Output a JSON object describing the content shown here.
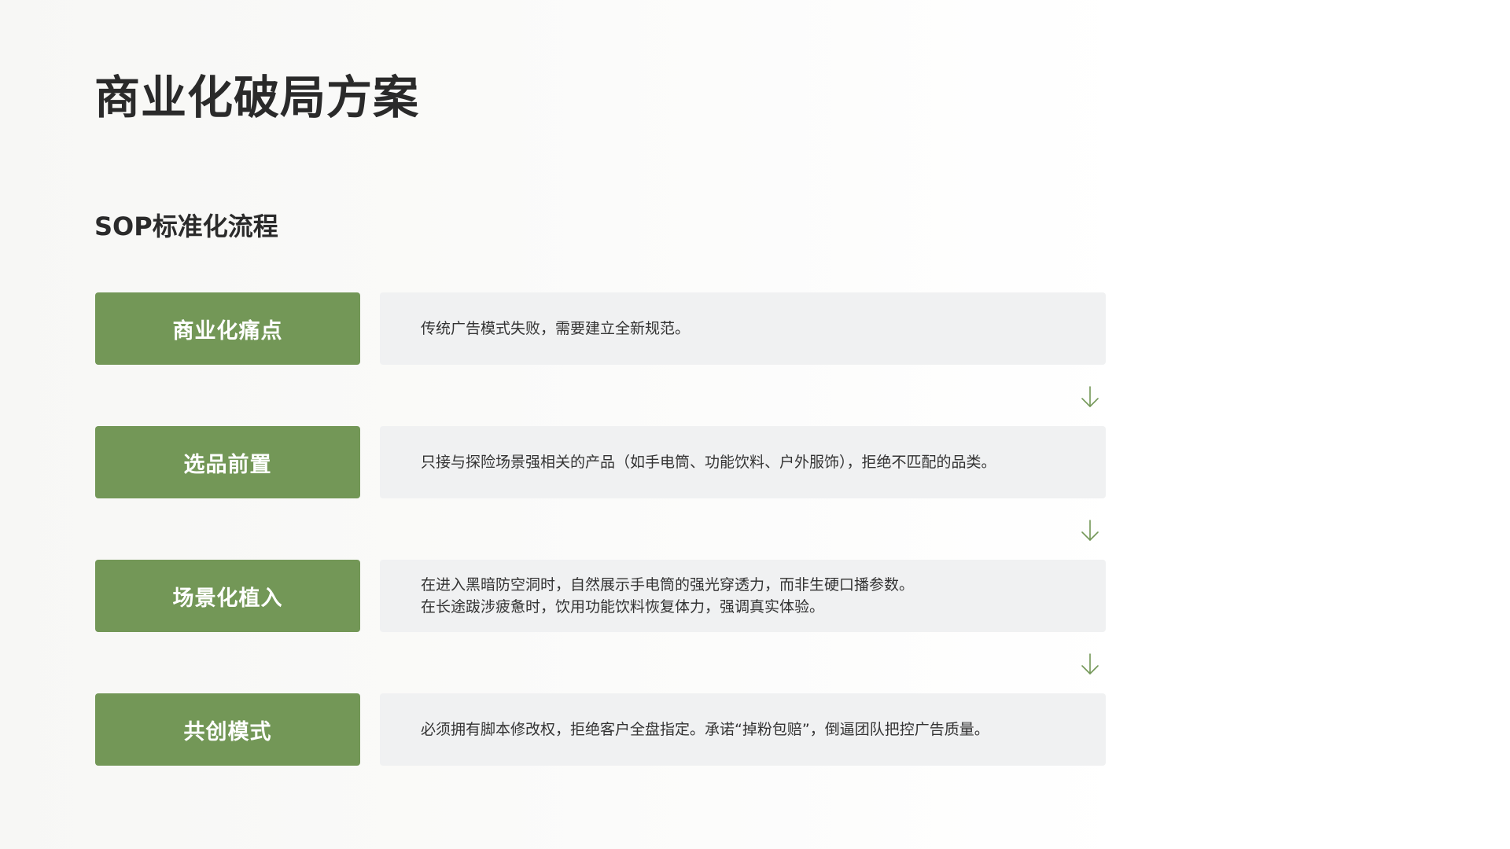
{
  "header": {
    "title": "商业化破局方案"
  },
  "section": {
    "title": "SOP标准化流程"
  },
  "steps": [
    {
      "label": "商业化痛点",
      "lines": [
        "传统广告模式失败，需要建立全新规范。"
      ]
    },
    {
      "label": "选品前置",
      "lines": [
        "只接与探险场景强相关的产品（如手电筒、功能饮料、户外服饰），拒绝不匹配的品类。"
      ]
    },
    {
      "label": "场景化植入",
      "lines": [
        "在进入黑暗防空洞时，自然展示手电筒的强光穿透力，而非生硬口播参数。",
        "在长途跋涉疲惫时，饮用功能饮料恢复体力，强调真实体验。"
      ]
    },
    {
      "label": "共创模式",
      "lines": [
        "必须拥有脚本修改权，拒绝客户全盘指定。承诺“掉粉包赔”，倒逼团队把控广告质量。"
      ]
    }
  ],
  "connector": {
    "icon": "arrow-down-icon"
  },
  "colors": {
    "accent": "#739757",
    "desc_background": "#f0f1f2",
    "title_text": "#2a2a2a"
  }
}
